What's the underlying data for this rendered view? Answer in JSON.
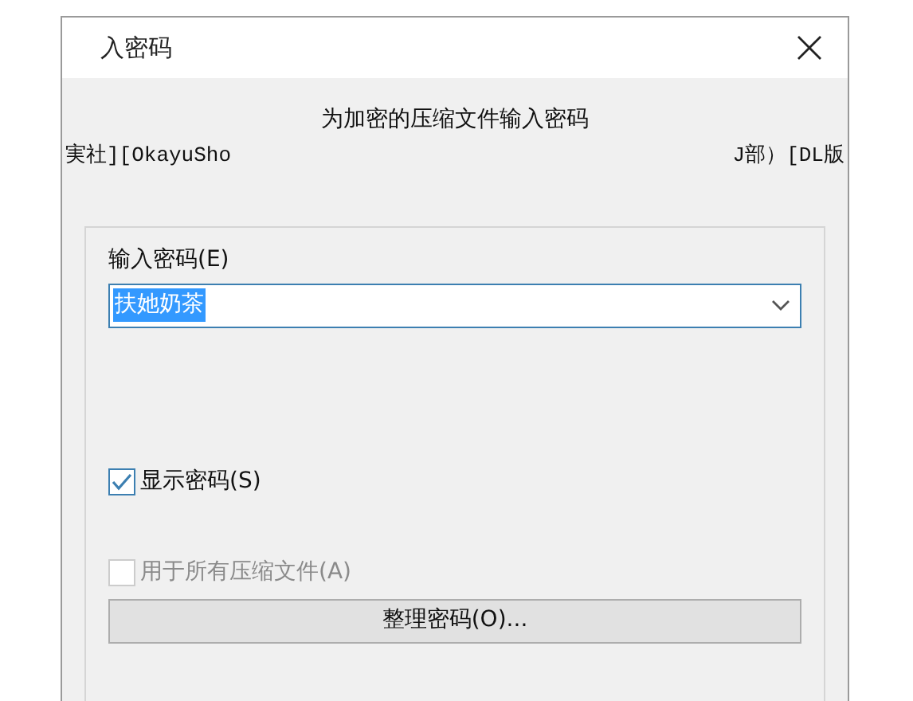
{
  "window": {
    "title": "入密码"
  },
  "heading": "为加密的压缩文件输入密码",
  "file_name": {
    "left": "実社][OkayuSho",
    "right": "J部）[DL版"
  },
  "password": {
    "label": "输入密码(E)",
    "value": "扶她奶茶",
    "selected_text": true
  },
  "checkboxes": [
    {
      "label": "显示密码(S)",
      "checked": true,
      "disabled": false
    },
    {
      "label": "用于所有压缩文件(A)",
      "checked": false,
      "disabled": true
    }
  ],
  "organize_button": {
    "label": "整理密码(O)..."
  }
}
